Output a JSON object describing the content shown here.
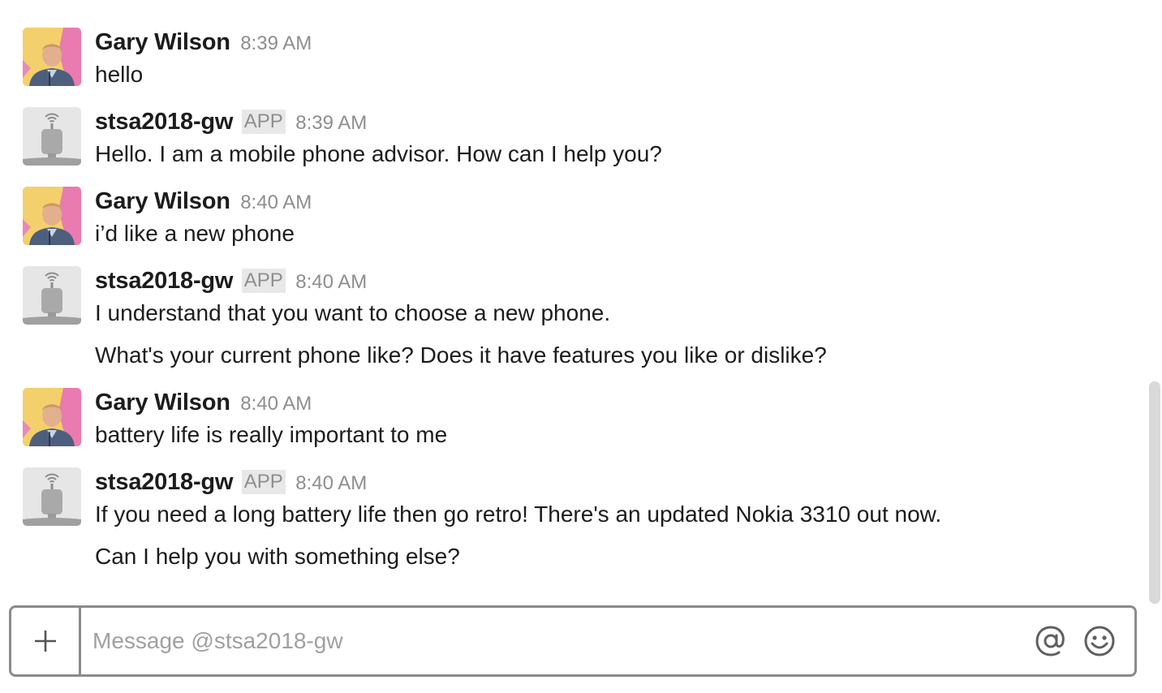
{
  "users": {
    "gary": {
      "name": "Gary Wilson",
      "avatar_icon": "person-photo"
    },
    "bot": {
      "name": "stsa2018-gw",
      "badge": "APP",
      "avatar_icon": "robot-antenna-icon"
    }
  },
  "messages": [
    {
      "sender": "Gary Wilson",
      "time": "8:39 AM",
      "lines": [
        "hello"
      ]
    },
    {
      "sender": "stsa2018-gw",
      "badge": "APP",
      "time": "8:39 AM",
      "lines": [
        "Hello. I am a mobile phone advisor. How can I help you?"
      ]
    },
    {
      "sender": "Gary Wilson",
      "time": "8:40 AM",
      "lines": [
        "i’d like a new phone"
      ]
    },
    {
      "sender": "stsa2018-gw",
      "badge": "APP",
      "time": "8:40 AM",
      "lines": [
        "I understand that you want to choose a new phone.",
        "What's your current phone like? Does it have features you like or dislike?"
      ]
    },
    {
      "sender": "Gary Wilson",
      "time": "8:40 AM",
      "lines": [
        "battery life is really important to me"
      ]
    },
    {
      "sender": "stsa2018-gw",
      "badge": "APP",
      "time": "8:40 AM",
      "lines": [
        "If you need a long battery life then go retro! There's an updated Nokia 3310 out now.",
        "Can I help you with something else?"
      ]
    }
  ],
  "composer": {
    "placeholder": "Message @stsa2018-gw",
    "value": "",
    "attach_icon": "plus-icon",
    "mention_icon": "at-sign-icon",
    "emoji_icon": "smiley-icon"
  },
  "colors": {
    "text": "#1d1c1d",
    "muted": "#8e8e8e",
    "badge_bg": "#e8e8e8",
    "border": "#8b8b8b"
  }
}
